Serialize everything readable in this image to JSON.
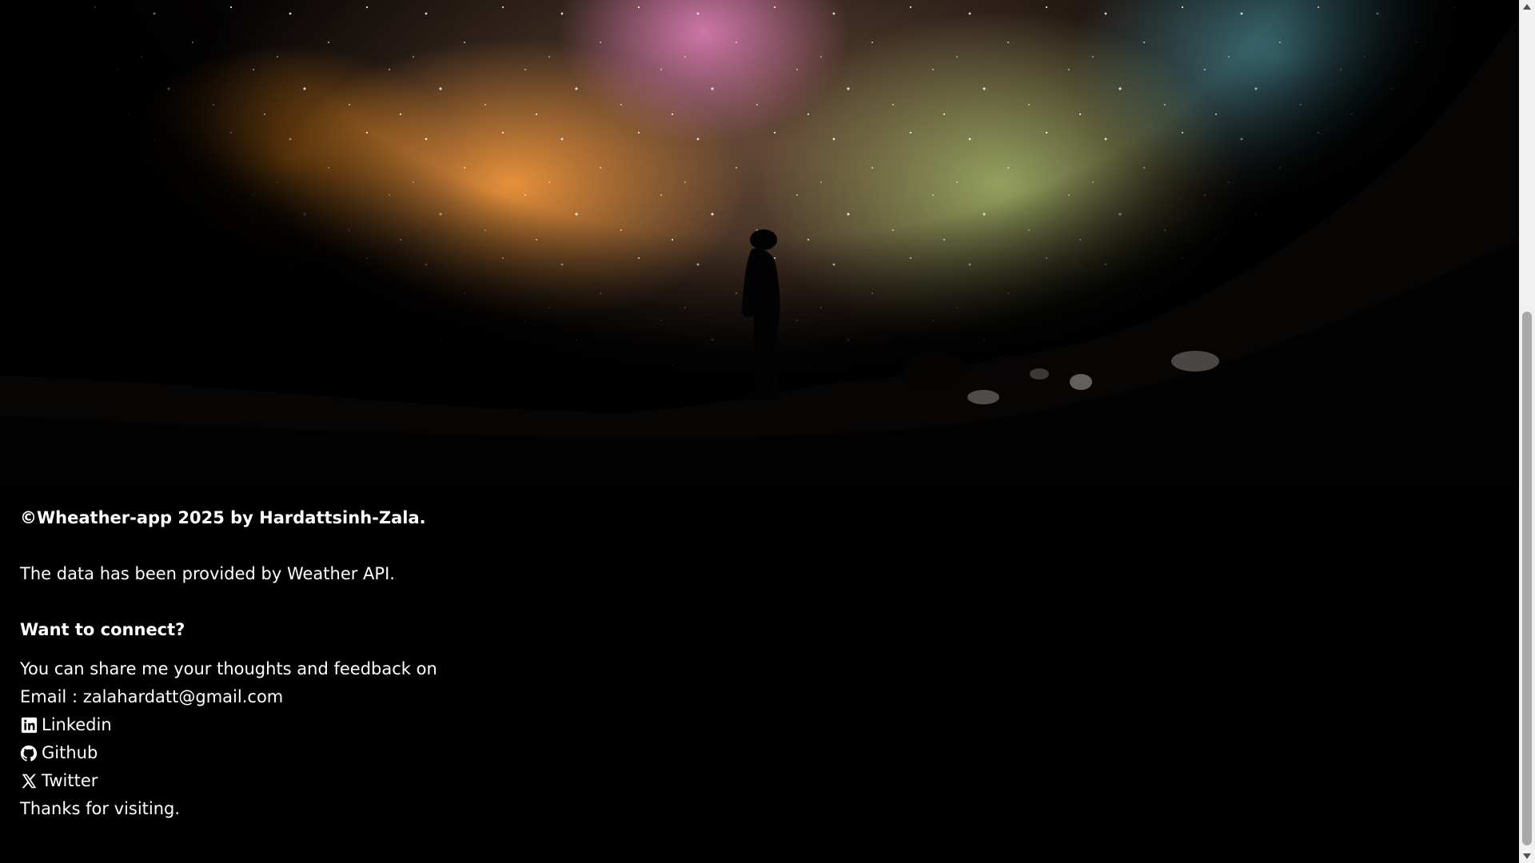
{
  "footer": {
    "copyright": "©Wheather-app 2025 by Hardattsinh-Zala.",
    "credit": "The data has been provided by Weather API.",
    "connect_heading": "Want to connect?",
    "share_line": "You can share me your thoughts and feedback on",
    "email_line": "Email : zalahardatt@gmail.com",
    "links": {
      "linkedin": {
        "label": "Linkedin",
        "icon": "linkedin-icon"
      },
      "github": {
        "label": "Github",
        "icon": "github-icon"
      },
      "twitter": {
        "label": "Twitter",
        "icon": "x-twitter-icon"
      }
    },
    "thanks": "Thanks for visiting."
  },
  "colors": {
    "background": "#000000",
    "text": "#ffffff",
    "scrollbar_track": "#f1f1f1",
    "scrollbar_thumb": "#a8a8a8"
  }
}
